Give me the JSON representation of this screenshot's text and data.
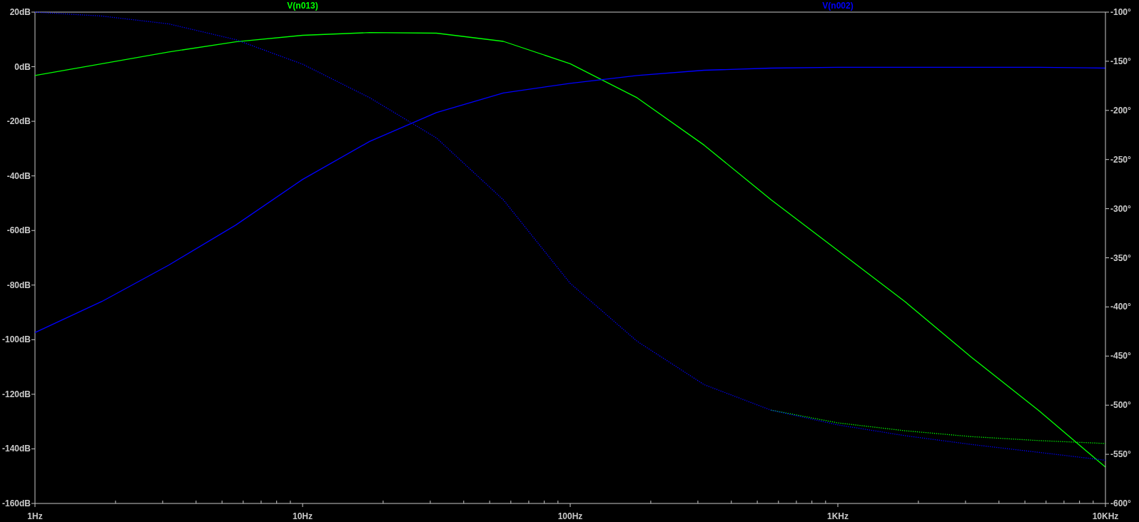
{
  "magnitude_plot": {
    "chart_data": {
      "type": "line",
      "categories": [
        "1Hz",
        null,
        null,
        null,
        "10Hz",
        null,
        null,
        null,
        "100Hz",
        null,
        null,
        null,
        "1KHz",
        null,
        null,
        null,
        "10KHz"
      ],
      "ylim": [
        -160,
        20
      ],
      "yticks": [
        {
          "value": 20,
          "label": "20dB"
        },
        {
          "value": 0,
          "label": "0dB"
        },
        {
          "value": -20,
          "label": "-20dB"
        },
        {
          "value": -40,
          "label": "-40dB"
        },
        {
          "value": -60,
          "label": "-60dB"
        },
        {
          "value": -80,
          "label": "-80dB"
        },
        {
          "value": -100,
          "label": "-100dB"
        },
        {
          "value": -120,
          "label": "-120dB"
        },
        {
          "value": -140,
          "label": "-140dB"
        },
        {
          "value": -160,
          "label": "-160dB"
        }
      ],
      "series": [
        {
          "name": "V(n013)",
          "color": "#00ff00",
          "values": [
            -3.2,
            1.1,
            5.4,
            9.1,
            11.5,
            12.5,
            12.3,
            9.3,
            1.1,
            -11.4,
            -28.7,
            -48.7,
            -67.3,
            -86,
            -106.5,
            -125.9,
            -146.7
          ]
        },
        {
          "name": "V(n002)",
          "color": "#0000ff",
          "values": [
            -97.4,
            -86,
            -72.7,
            -58,
            -41.3,
            -27.4,
            -16.8,
            -9.6,
            -6.1,
            -3.2,
            -1.3,
            -0.5,
            -0.2,
            -0.2,
            -0.2,
            -0.2,
            -0.5
          ]
        }
      ]
    }
  },
  "phase_plot": {
    "chart_data": {
      "type": "line",
      "categories": [
        null,
        null,
        null,
        null,
        null,
        null,
        null,
        null,
        null,
        null,
        null,
        null,
        null,
        null,
        null,
        null,
        null
      ],
      "ylim": [
        -600,
        -100
      ],
      "yticks": [
        {
          "value": -100,
          "label": "-100°"
        },
        {
          "value": -150,
          "label": "-150°"
        },
        {
          "value": -200,
          "label": "-200°"
        },
        {
          "value": -250,
          "label": "-250°"
        },
        {
          "value": -300,
          "label": "-300°"
        },
        {
          "value": -350,
          "label": "-350°"
        },
        {
          "value": -400,
          "label": "-400°"
        },
        {
          "value": -450,
          "label": "-450°"
        },
        {
          "value": -500,
          "label": "-500°"
        },
        {
          "value": -550,
          "label": "-550°"
        },
        {
          "value": -600,
          "label": "-600°"
        }
      ],
      "series": [
        {
          "color": "#00ff00",
          "line_style": "dotted",
          "values": [
            null,
            null,
            null,
            null,
            null,
            null,
            null,
            null,
            null,
            null,
            null,
            -505,
            -518,
            -526,
            -532,
            -536,
            -539
          ]
        },
        {
          "color": "#0000ff",
          "line_style": "dotted",
          "values": [
            -100,
            -104,
            -112,
            -128,
            -153,
            -187,
            -228,
            -291,
            -376,
            -435,
            -479,
            -505,
            -520,
            -531,
            -540,
            -548,
            -556
          ]
        }
      ]
    }
  }
}
